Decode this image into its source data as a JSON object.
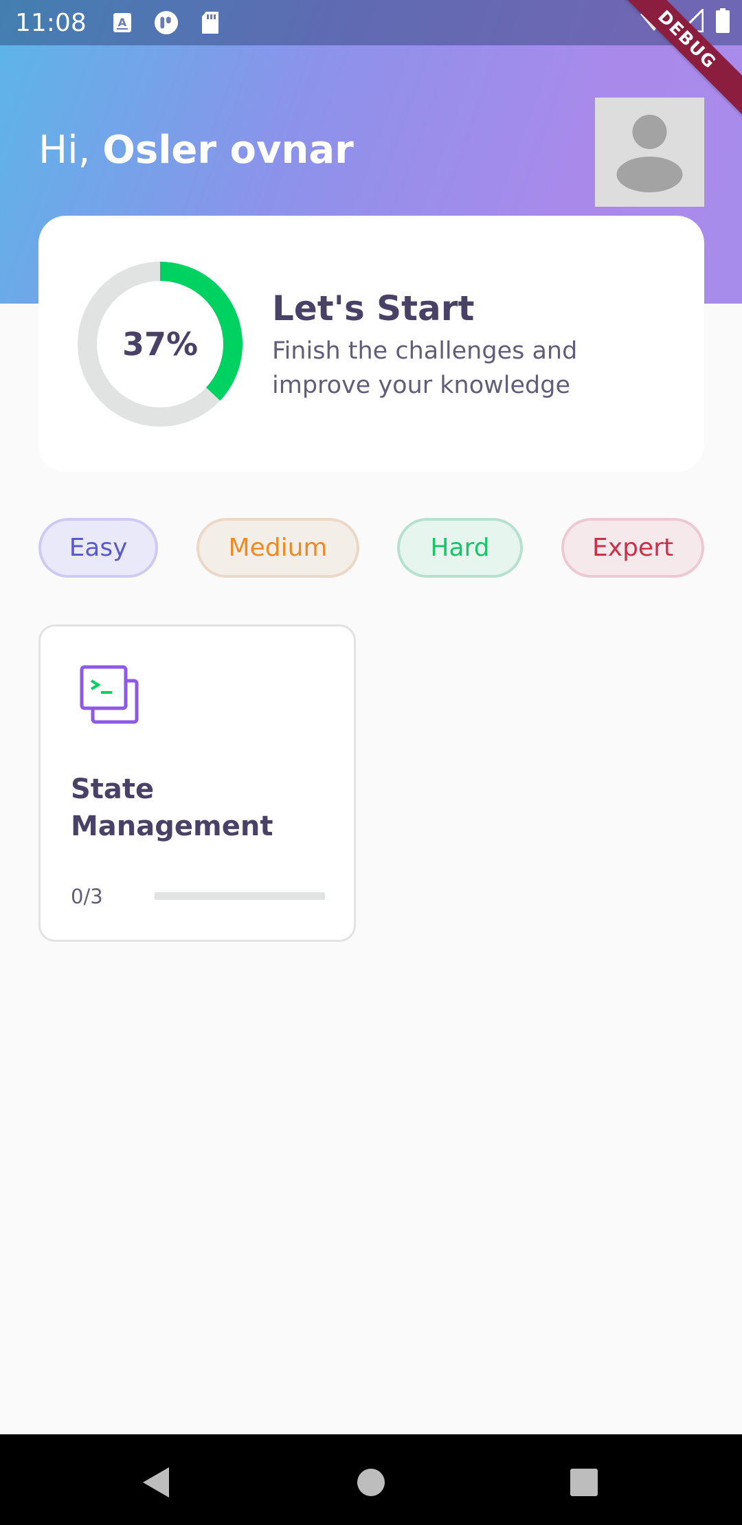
{
  "status_bar": {
    "time": "11:08",
    "left_icons": [
      "keyboard-a-icon",
      "app-icon",
      "sd-card-icon"
    ],
    "right_icons": [
      "wifi-icon",
      "signal-icon",
      "battery-icon"
    ]
  },
  "debug_banner": "DEBUG",
  "header": {
    "greeting_prefix": "Hi, ",
    "user_name": "Osler ovnar",
    "avatar": "person-placeholder-icon"
  },
  "progress_card": {
    "percent_label": "37%",
    "progress_fraction": 0.37,
    "title": "Let's Start",
    "description": "Finish the challenges and improve your knowledge"
  },
  "difficulty_filters": [
    {
      "label": "Easy",
      "color": "#5A59C8"
    },
    {
      "label": "Medium",
      "color": "#EE8A24"
    },
    {
      "label": "Hard",
      "color": "#16C56A"
    },
    {
      "label": "Expert",
      "color": "#CC2F49"
    }
  ],
  "topics": [
    {
      "icon": "terminal-icon",
      "title": "State Management",
      "progress_text": "0/3",
      "progress_fraction": 0
    }
  ],
  "nav": [
    "back-icon",
    "home-icon",
    "recents-icon"
  ],
  "colors": {
    "accent_green": "#00D261",
    "ring_track": "#E0E3E2",
    "text_dark": "#4A4266"
  }
}
